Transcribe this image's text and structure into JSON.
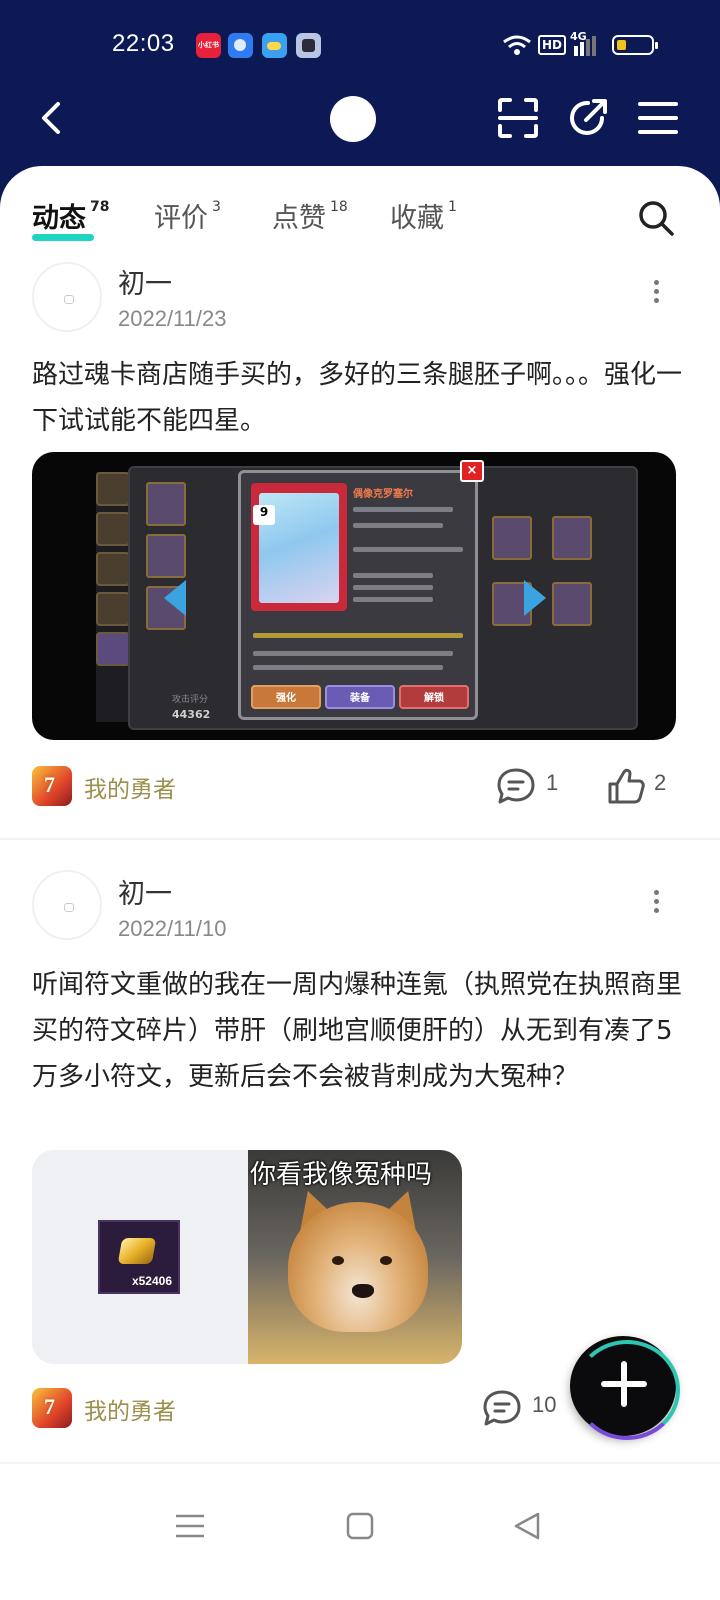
{
  "status_bar": {
    "time": "22:03",
    "notification_icons": [
      "xiaohongshu-icon",
      "browser-icon",
      "weather-icon",
      "cat-app-icon"
    ],
    "network_badge": "HD",
    "signal_label": "4G"
  },
  "header": {
    "back_icon": "chevron-left-icon",
    "scan_icon": "scan-icon",
    "share_icon": "share-icon",
    "menu_icon": "hamburger-icon",
    "background_color": "#0d1954"
  },
  "tabs": [
    {
      "label": "动态",
      "count": "78",
      "active": true
    },
    {
      "label": "评价",
      "count": "3",
      "active": false
    },
    {
      "label": "点赞",
      "count": "18",
      "active": false
    },
    {
      "label": "收藏",
      "count": "1",
      "active": false
    }
  ],
  "accent_color": "#1fd4c0",
  "posts": [
    {
      "username": "初一",
      "date": "2022/11/23",
      "text": "路过魂卡商店随手买的，多好的三条腿胚子啊。。。强化一下试试能不能四星。",
      "image": {
        "card_title": "偶像克罗塞尔",
        "card_level": "9",
        "buttons": [
          "强化",
          "装备",
          "解锁"
        ],
        "score_label": "攻击评分",
        "score": "44362"
      },
      "game": "我的勇者",
      "comments": "1",
      "likes": "2"
    },
    {
      "username": "初一",
      "date": "2022/11/10",
      "text": "听闻符文重做的我在一周内爆种连氪（执照党在执照商里买的符文碎片）带肝（刷地宫顺便肝的）从无到有凑了5万多小符文，更新后会不会被背刺成为大冤种？",
      "image_left": {
        "count": "x52406"
      },
      "image_right": {
        "caption": "你看我像冤种吗"
      },
      "game": "我的勇者",
      "comments": "10"
    }
  ],
  "fab_icon": "plus-icon",
  "system_nav": [
    "menu-icon",
    "home-icon",
    "back-icon"
  ]
}
